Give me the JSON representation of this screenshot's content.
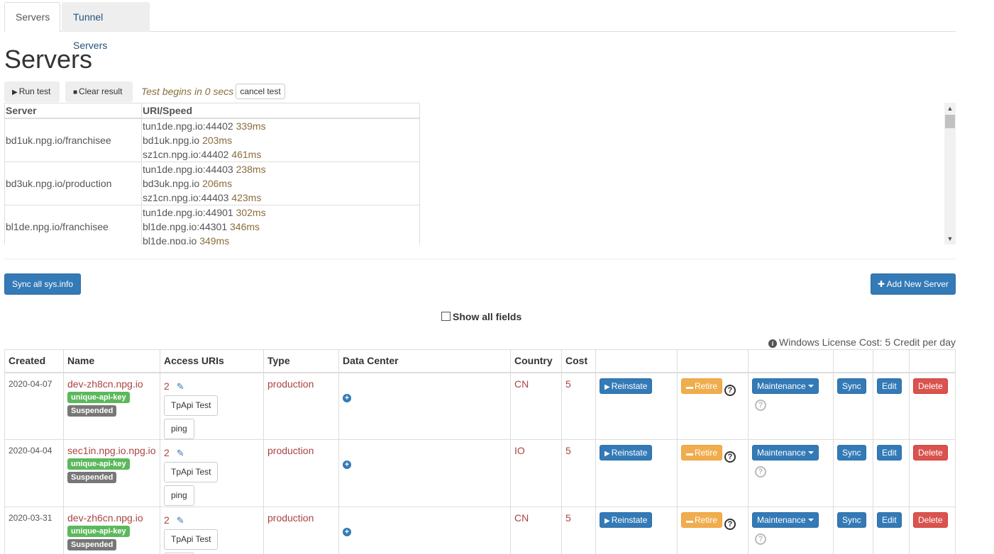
{
  "tabs": [
    "Servers",
    "Tunnel Servers"
  ],
  "page_title": "Servers",
  "toolbar": {
    "run_test": "Run test",
    "clear_result": "Clear result",
    "test_message": "Test begins in 0 secs",
    "cancel_test": "cancel test"
  },
  "results": {
    "headers": [
      "Server",
      "URI/Speed"
    ],
    "rows": [
      {
        "server": "bd1uk.npg.io/franchisee",
        "uris": [
          {
            "uri": "tun1de.npg.io:44402",
            "ms": "339ms"
          },
          {
            "uri": "bd1uk.npg.io",
            "ms": "203ms"
          },
          {
            "uri": "sz1cn.npg.io:44402",
            "ms": "461ms"
          }
        ]
      },
      {
        "server": "bd3uk.npg.io/production",
        "uris": [
          {
            "uri": "tun1de.npg.io:44403",
            "ms": "238ms"
          },
          {
            "uri": "bd3uk.npg.io",
            "ms": "206ms"
          },
          {
            "uri": "sz1cn.npg.io:44403",
            "ms": "423ms"
          }
        ]
      },
      {
        "server": "bl1de.npg.io/franchisee",
        "uris": [
          {
            "uri": "tun1de.npg.io:44901",
            "ms": "302ms"
          },
          {
            "uri": "bl1de.npg.io:44301",
            "ms": "346ms"
          },
          {
            "uri": "bl1de.npg.io",
            "ms": "349ms"
          }
        ]
      }
    ]
  },
  "actions": {
    "sync_all": "Sync all sys.info",
    "add_new": "Add New Server",
    "show_all_fields": "Show all fields",
    "license_note": "Windows License Cost: 5 Credit per day"
  },
  "table": {
    "headers": [
      "Created",
      "Name",
      "Access URIs",
      "Type",
      "Data Center",
      "Country",
      "Cost",
      "",
      "",
      "",
      "",
      "",
      ""
    ],
    "rows": [
      {
        "created": "2020-04-07",
        "name": "dev-zh8cn.npg.io",
        "badge_key": "unique-api-key",
        "badge_status": "Suspended",
        "uri_count": "2",
        "type": "production",
        "country": "CN",
        "cost": "5"
      },
      {
        "created": "2020-04-04",
        "name": "sec1in.npg.io.npg.io",
        "badge_key": "unique-api-key",
        "badge_status": "Suspended",
        "uri_count": "2",
        "type": "production",
        "country": "IO",
        "cost": "5"
      },
      {
        "created": "2020-03-31",
        "name": "dev-zh6cn.npg.io",
        "badge_key": "unique-api-key",
        "badge_status": "Suspended",
        "uri_count": "2",
        "type": "production",
        "country": "CN",
        "cost": "5"
      }
    ],
    "row_buttons": {
      "tpapi": "TpApi Test",
      "ping": "ping",
      "reinstate": "Reinstate",
      "retire": "Retire",
      "maintenance": "Maintenance",
      "sync": "Sync",
      "edit": "Edit",
      "delete": "Delete"
    }
  },
  "colors": {
    "primary": "#337ab7",
    "warning": "#f0ad4e",
    "danger": "#d9534f",
    "success": "#5cb85c",
    "link_red": "#a94442",
    "speed": "#8a6d3b"
  }
}
